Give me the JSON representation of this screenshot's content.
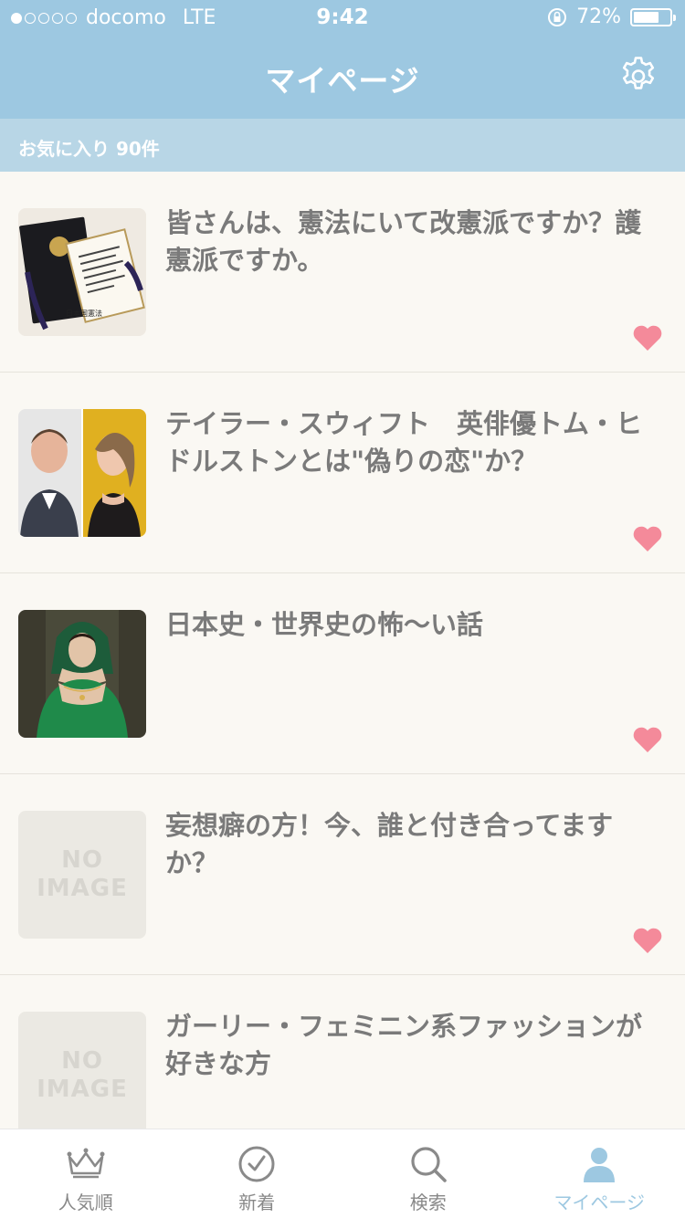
{
  "status_bar": {
    "carrier": "docomo",
    "network": "LTE",
    "time": "9:42",
    "battery": "72%",
    "battery_level": 0.72,
    "signal_bars": 1
  },
  "header": {
    "title": "マイページ",
    "settings_icon": "gear-icon"
  },
  "section": {
    "label": "お気に入り 90件"
  },
  "items": [
    {
      "title": "皆さんは、憲法にいて改憲派ですか？護憲派ですか。",
      "thumb": "constitution-book-image",
      "thumb_caption": "日本国憲法",
      "favorited": true
    },
    {
      "title": "テイラー・スウィフト　英俳優トム・ヒドルストンとは\"偽りの恋\"か？",
      "thumb": "celebrity-couple-image",
      "favorited": true
    },
    {
      "title": "日本史・世界史の怖〜い話",
      "thumb": "historical-portrait-image",
      "favorited": true
    },
    {
      "title": "妄想癖の方！今、誰と付き合ってますか？",
      "thumb": "no-image",
      "noimage_lines": [
        "NO",
        "IMAGE"
      ],
      "favorited": true
    },
    {
      "title": "ガーリー・フェミニン系ファッションが好きな方",
      "thumb": "no-image",
      "noimage_lines": [
        "NO",
        "IMAGE"
      ],
      "favorited": true
    }
  ],
  "tab_bar": {
    "tabs": [
      {
        "label": "人気順",
        "icon": "crown-icon"
      },
      {
        "label": "新着",
        "icon": "clock-icon"
      },
      {
        "label": "検索",
        "icon": "search-icon"
      },
      {
        "label": "マイページ",
        "icon": "person-icon"
      }
    ],
    "active_index": 3
  },
  "colors": {
    "header": "#9dc8e1",
    "section_header": "#b8d6e6",
    "background": "#faf8f3",
    "heart": "#f48a9a",
    "title_text": "#7a7a7a"
  }
}
